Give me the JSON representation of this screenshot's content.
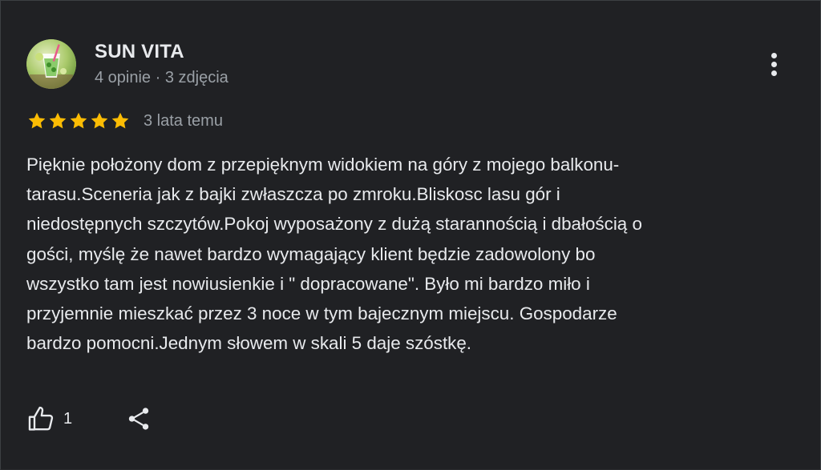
{
  "reviewer": {
    "name": "SUN VITA",
    "meta": "4 opinie · 3 zdjęcia",
    "avatar_icon": "drink-glass-avatar"
  },
  "rating": {
    "stars": 5,
    "max": 5,
    "star_color": "#fbbc04",
    "date": "3 lata temu"
  },
  "review": {
    "lines": [
      "Pięknie położony dom z przepięknym widokiem na góry z mojego balkonu-",
      "tarasu.Sceneria jak z bajki zwłaszcza po zmroku.Bliskosc lasu gór i",
      "niedostępnych szczytów.Pokoj wyposażony z dużą starannością i dbałością o",
      "gości, myślę że nawet bardzo wymagający klient będzie zadowolony bo",
      "wszystko tam jest nowiusienkie i \" dopracowane\". Było mi bardzo miło i",
      "przyjemnie mieszkać przez 3 noce w tym bajecznym miejscu. Gospodarze",
      "bardzo pomocni.Jednym słowem w skali 5 daje szóstkę."
    ]
  },
  "actions": {
    "like_count": "1",
    "like_icon": "thumbs-up-icon",
    "share_icon": "share-icon",
    "more_icon": "more-vert-icon"
  },
  "colors": {
    "background": "#202124",
    "text": "#e8eaed",
    "secondary_text": "#9aa0a6"
  }
}
